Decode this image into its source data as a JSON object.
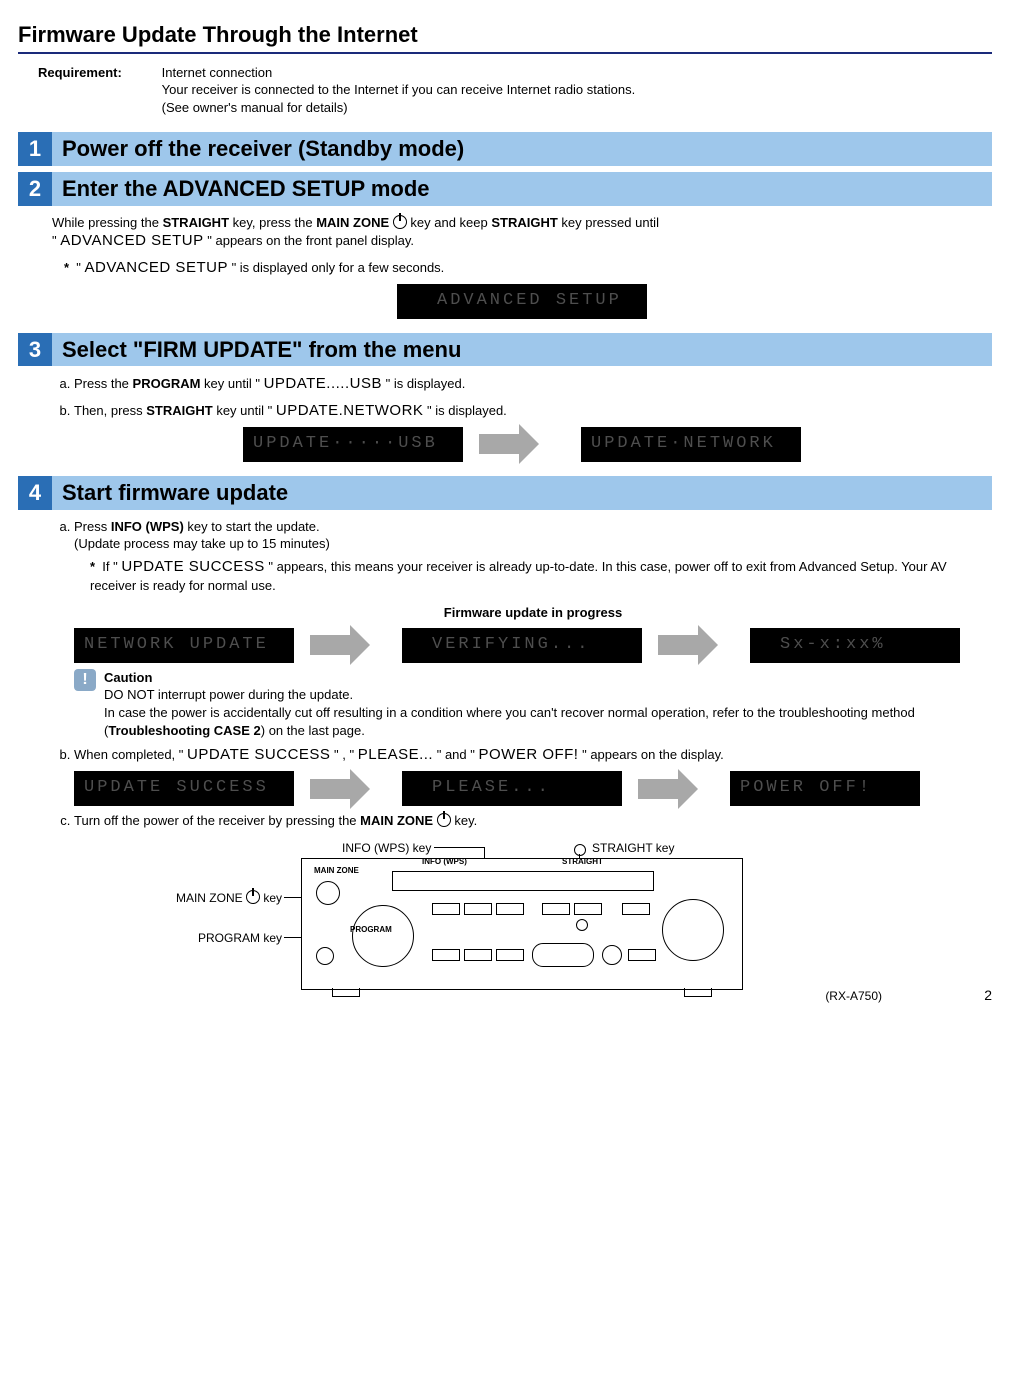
{
  "page": {
    "title": "Firmware Update Through the Internet",
    "number": "2"
  },
  "requirement": {
    "label": "Requirement:",
    "line1": "Internet connection",
    "line2": "Your receiver is connected to the Internet if you can receive Internet radio stations.",
    "line3": "(See owner's manual for details)"
  },
  "steps": [
    {
      "num": "1",
      "title": "Power off the receiver (Standby mode)"
    },
    {
      "num": "2",
      "title": "Enter the ADVANCED SETUP mode"
    },
    {
      "num": "3",
      "title": "Select \"FIRM UPDATE\" from the menu"
    },
    {
      "num": "4",
      "title": "Start firmware update"
    }
  ],
  "step2": {
    "p1_a": "While pressing the ",
    "p1_b": " key, press the ",
    "p1_c": " key and keep ",
    "p1_d": " key pressed until",
    "straight": "STRAIGHT",
    "mainzone": "MAIN ZONE",
    "quote_open": "\" ",
    "adv_setup": "ADVANCED SETUP",
    "quote_close": " \" appears on the front panel display.",
    "note_prefix": "*",
    "note_text_a": "\" ",
    "note_text_b": " \" is displayed only for a few seconds.",
    "lcd": "ADVANCED SETUP"
  },
  "step3": {
    "a_pre": "Press the ",
    "program": "PROGRAM",
    "a_mid": " key until \" ",
    "update_usb": "UPDATE.....USB",
    "a_end": " \" is displayed.",
    "b_pre": "Then, press ",
    "straight": "STRAIGHT",
    "b_mid": " key until \" ",
    "update_net": "UPDATE.NETWORK",
    "b_end": " \" is displayed.",
    "lcd1": "UPDATE·····USB",
    "lcd2": "UPDATE·NETWORK"
  },
  "step4": {
    "a_pre": "Press ",
    "info": "INFO (WPS)",
    "a_post": " key to start the update.",
    "a_sub": "(Update process may take up to 15 minutes)",
    "star": "*",
    "star_a": "If \" ",
    "update_success": "UPDATE SUCCESS",
    "star_b": " \" appears, this means your receiver is already up-to-date. In this case, power off to exit from Advanced Setup. Your AV receiver is ready for normal use.",
    "progress_caption": "Firmware update in progress",
    "lcd_a": "NETWORK UPDATE",
    "lcd_b": "VERIFYING...",
    "lcd_c": "Sx-x:xx%",
    "caution": {
      "title": "Caution",
      "l1": "DO NOT interrupt power during the update.",
      "l2_a": "In case the power is accidentally cut off resulting in a condition where you can't recover normal operation, refer to the troubleshooting method (",
      "l2_b": "Troubleshooting CASE 2",
      "l2_c": ") on the last page."
    },
    "b_pre": "When completed, \" ",
    "b_s1": "UPDATE SUCCESS",
    "b_mid1": " \" , \" ",
    "b_s2": "PLEASE...",
    "b_mid2": " \" and \" ",
    "b_s3": "POWER OFF!",
    "b_end": " \" appears on the display.",
    "lcd_d": "UPDATE SUCCESS",
    "lcd_e": "PLEASE...",
    "lcd_f": "POWER OFF!",
    "c_pre": "Turn off the power of the receiver by pressing the ",
    "c_mainzone": "MAIN ZONE",
    "c_post": " key."
  },
  "device": {
    "info_label": "INFO (WPS) key",
    "straight_label": "STRAIGHT key",
    "mainzone_label": "MAIN ZONE",
    "mainzone_suffix": "key",
    "program_label": "PROGRAM key",
    "model": "(RX-A750)",
    "small_info": "INFO (WPS)",
    "small_straight": "STRAIGHT",
    "small_mainzone": "MAIN ZONE",
    "small_program": "PROGRAM"
  }
}
